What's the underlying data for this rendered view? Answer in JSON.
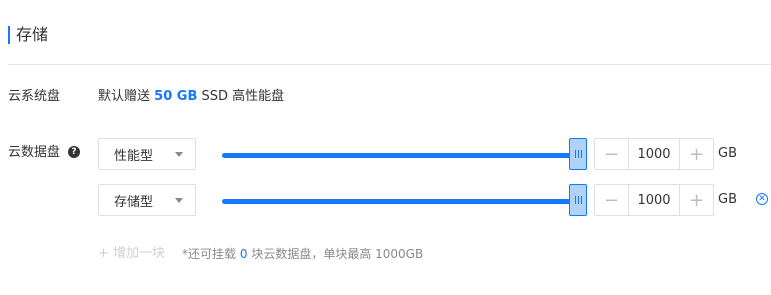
{
  "section": {
    "title": "存储"
  },
  "system_disk": {
    "label": "云系统盘",
    "desc_prefix": "默认赠送",
    "size": "50 GB",
    "desc_suffix": "SSD 高性能盘"
  },
  "data_disk": {
    "label": "云数据盘",
    "help_icon": "question-circle-icon",
    "disks": [
      {
        "type": "性能型",
        "slider_fraction": 1.0,
        "value": "1000",
        "unit": "GB",
        "removable": false
      },
      {
        "type": "存储型",
        "slider_fraction": 1.0,
        "value": "1000",
        "unit": "GB",
        "removable": true
      }
    ],
    "add_label": "+ 增加一块",
    "note_prefix": "*还可挂载",
    "note_count": "0",
    "note_suffix": "块云数据盘，单块最高 1000GB"
  },
  "colors": {
    "accent": "#1677ff",
    "handle_fill": "#aed3f7",
    "disabled": "#d0d0d0"
  }
}
